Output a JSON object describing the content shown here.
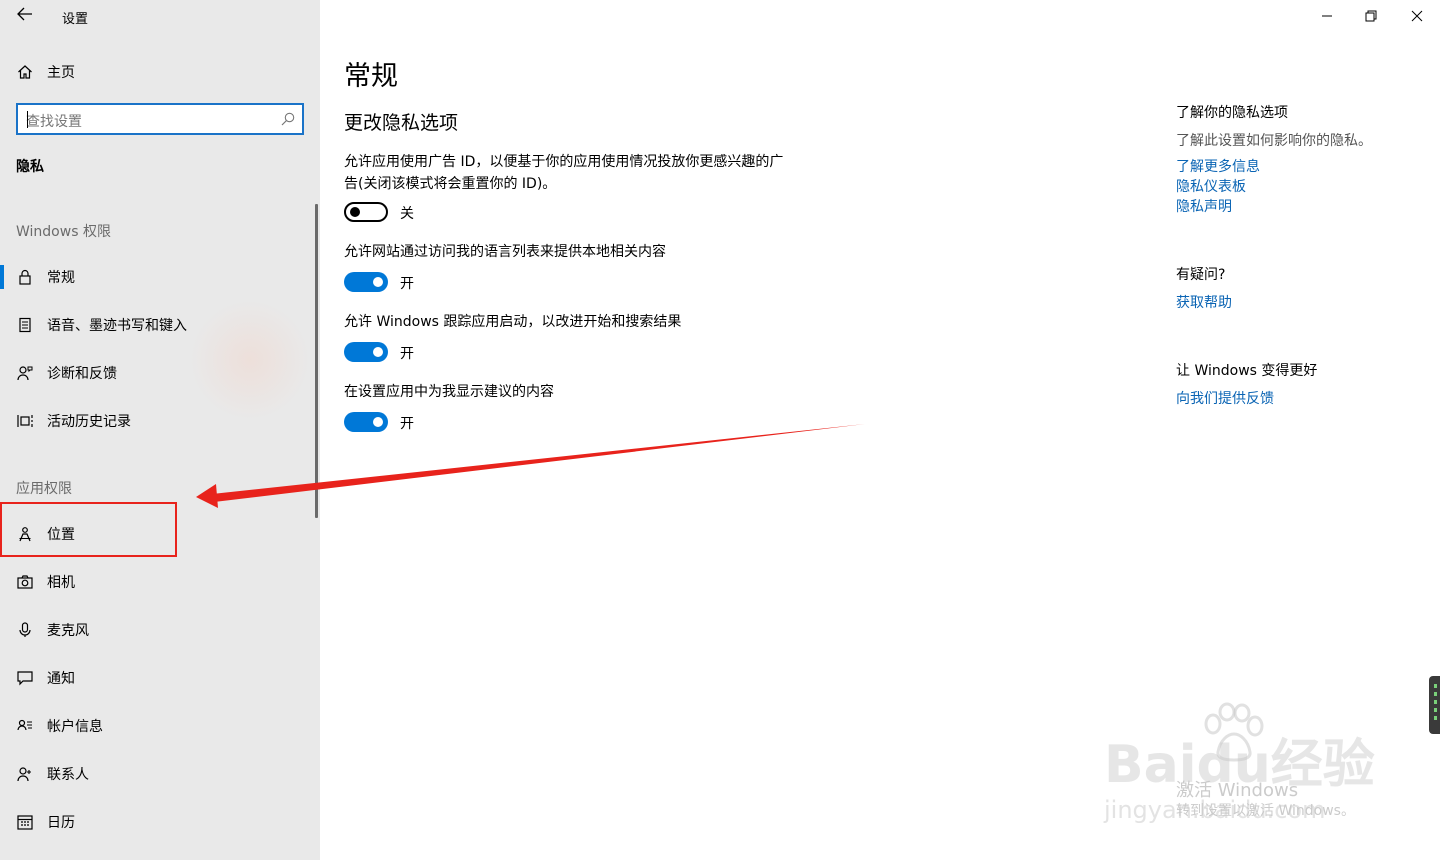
{
  "window": {
    "app_title": "设置",
    "back_icon": "back-arrow-icon",
    "controls": [
      "minimize-icon",
      "restore-icon",
      "close-icon"
    ]
  },
  "sidebar": {
    "home_label": "主页",
    "search_placeholder": "查找设置",
    "section": "隐私",
    "windows_group": "Windows 权限",
    "windows_items": [
      {
        "label": "常规",
        "icon": "lock-icon",
        "selected": true
      },
      {
        "label": "语音、墨迹书写和键入",
        "icon": "document-icon"
      },
      {
        "label": "诊断和反馈",
        "icon": "person-feedback-icon"
      },
      {
        "label": "活动历史记录",
        "icon": "history-icon"
      }
    ],
    "app_group": "应用权限",
    "app_items": [
      {
        "label": "位置",
        "icon": "location-icon"
      },
      {
        "label": "相机",
        "icon": "camera-icon"
      },
      {
        "label": "麦克风",
        "icon": "microphone-icon"
      },
      {
        "label": "通知",
        "icon": "notification-icon"
      },
      {
        "label": "帐户信息",
        "icon": "account-info-icon"
      },
      {
        "label": "联系人",
        "icon": "contacts-icon"
      },
      {
        "label": "日历",
        "icon": "calendar-icon"
      }
    ],
    "accent": "#0078d7"
  },
  "main": {
    "title": "常规",
    "subtitle": "更改隐私选项",
    "settings": [
      {
        "text": "允许应用使用广告 ID，以便基于你的应用使用情况投放你更感兴趣的广告(关闭该模式将会重置你的 ID)。",
        "state": "关",
        "on": false
      },
      {
        "text": "允许网站通过访问我的语言列表来提供本地相关内容",
        "state": "开",
        "on": true
      },
      {
        "text": "允许 Windows 跟踪应用启动，以改进开始和搜索结果",
        "state": "开",
        "on": true
      },
      {
        "text": "在设置应用中为我显示建议的内容",
        "state": "开",
        "on": true
      }
    ]
  },
  "rail": {
    "privacy_heading": "了解你的隐私选项",
    "privacy_text": "了解此设置如何影响你的隐私。",
    "links": [
      "了解更多信息",
      "隐私仪表板",
      "隐私声明"
    ],
    "question_heading": "有疑问?",
    "help_link": "获取帮助",
    "improve_heading": "让 Windows 变得更好",
    "feedback_link": "向我们提供反馈"
  },
  "overlay": {
    "activate_title": "激活 Windows",
    "activate_text": "转到设置以激活 Windows。",
    "watermark_brand": "Baidu经验",
    "watermark_url": "jingyan.baidu.com",
    "annotation_color": "#e8231c"
  }
}
